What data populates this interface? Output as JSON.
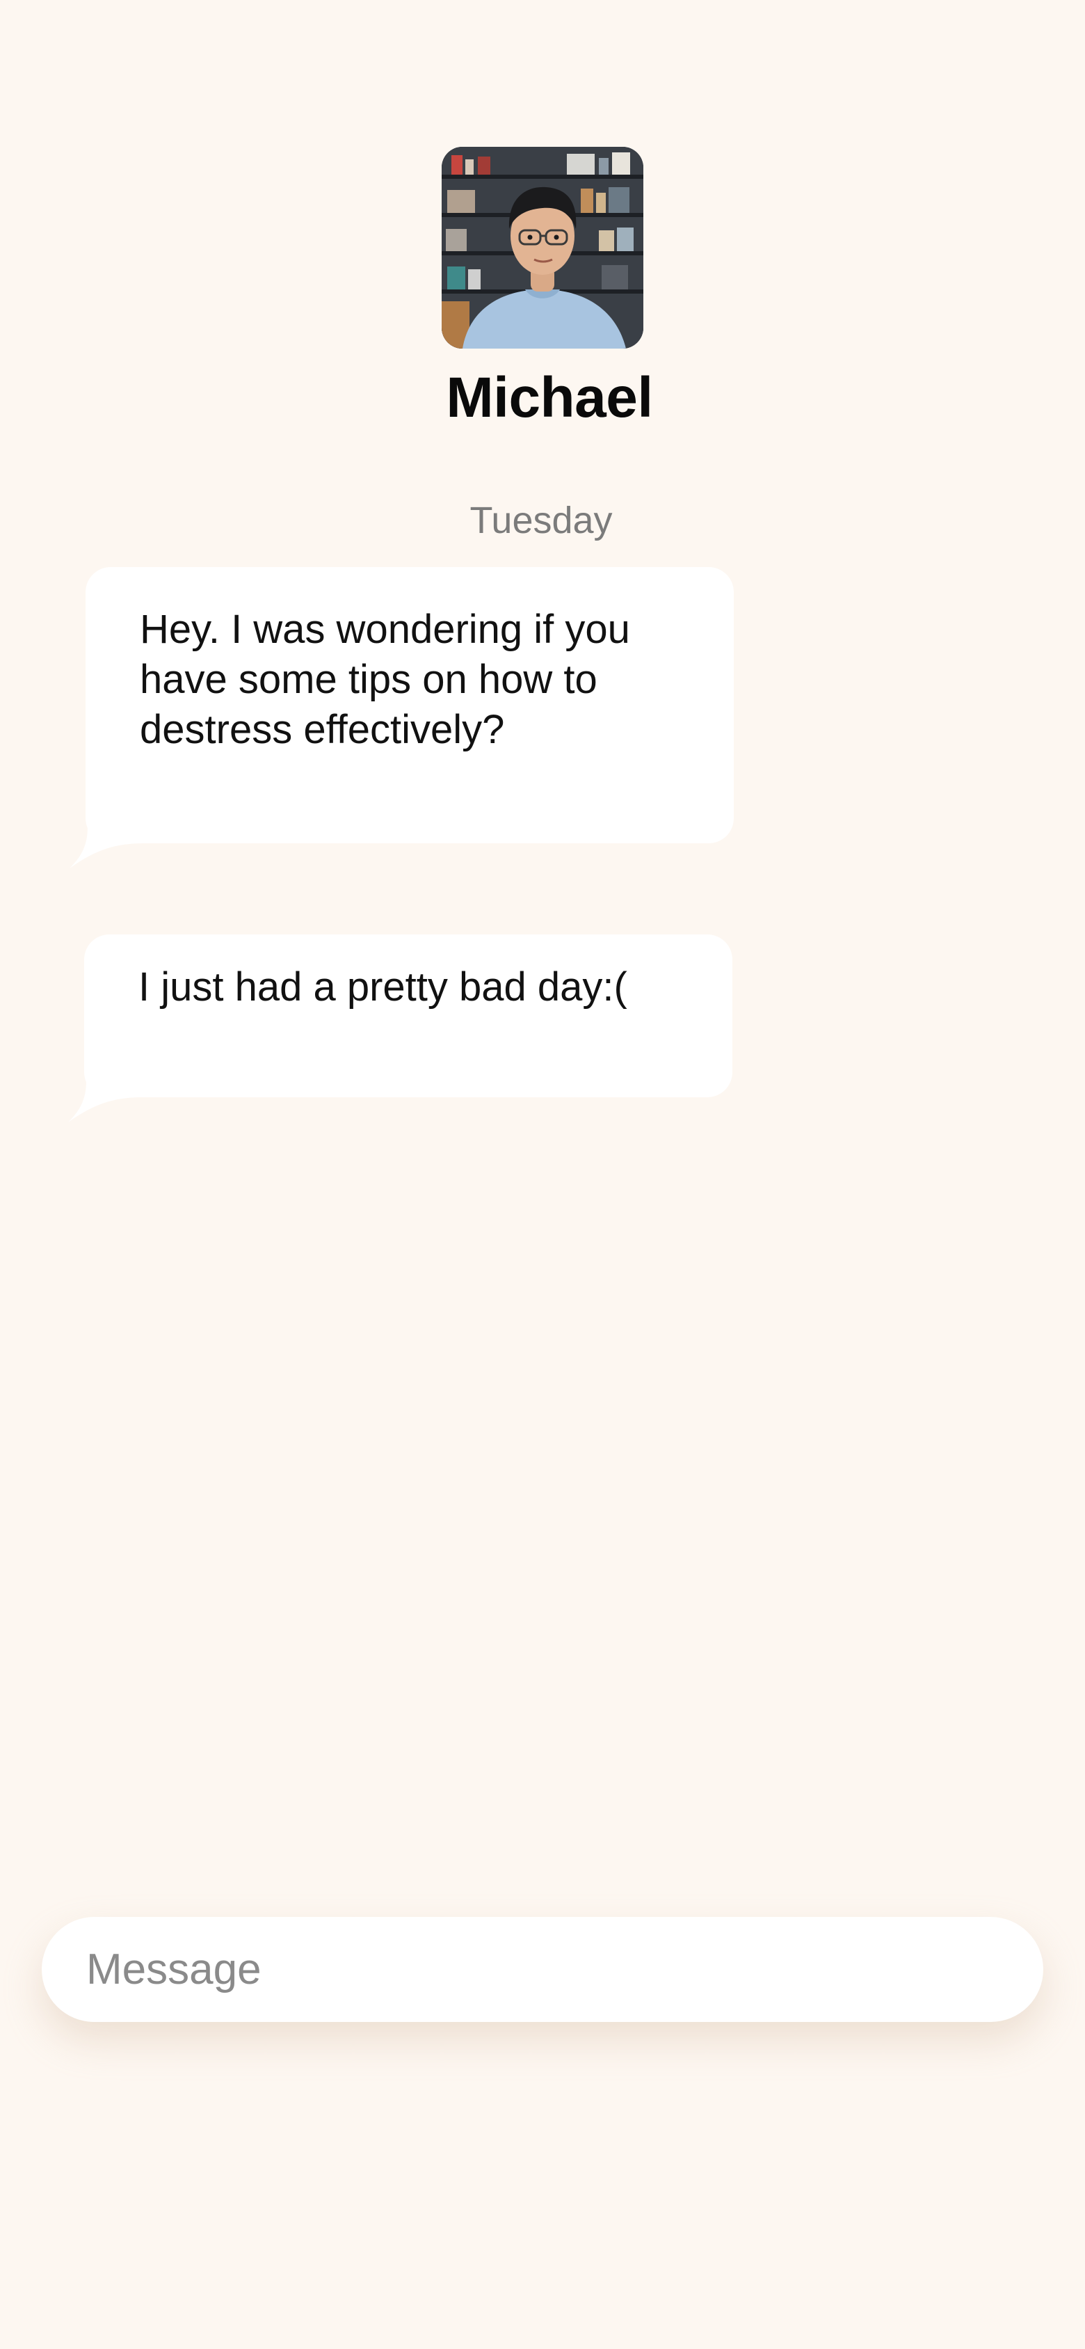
{
  "contact": {
    "name": "Michael"
  },
  "conversation": {
    "day_label": "Tuesday",
    "messages": [
      {
        "text": "Hey. I was wondering if you have some tips on how to destress effectively?"
      },
      {
        "text": "I just had a pretty bad day:("
      }
    ]
  },
  "composer": {
    "placeholder": "Message",
    "value": ""
  },
  "colors": {
    "background": "#fdf7f1",
    "bubble": "#ffffff",
    "name_text": "#0a0a0a",
    "muted_text": "#7b7b7b"
  }
}
